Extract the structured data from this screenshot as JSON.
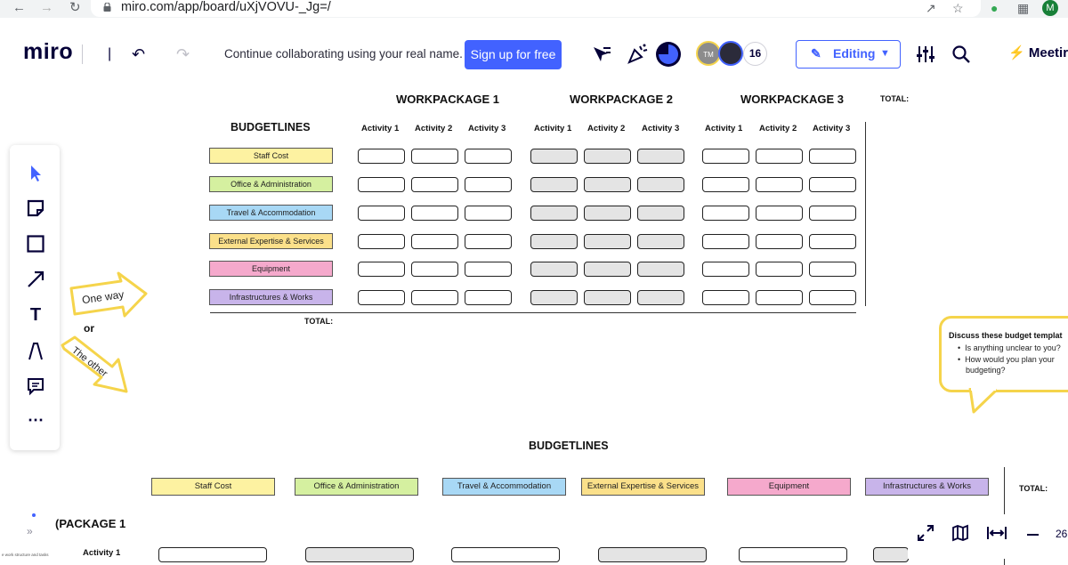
{
  "browser": {
    "url": "miro.com/app/board/uXjVOVU-_Jg=/",
    "profile_initial": "M"
  },
  "toolbar": {
    "logo": "miro",
    "cta_text": "Continue collaborating using your real name.",
    "signup_label": "Sign up for free",
    "avatar_tm": "TM",
    "collaborator_count": "16",
    "editing_label": "Editing",
    "meeting_label": "Meetir"
  },
  "board": {
    "workpackages": [
      "WORKPACKAGE 1",
      "WORKPACKAGE 2",
      "WORKPACKAGE 3"
    ],
    "total_header": "TOTAL:",
    "budgetlines_title": "BUDGETLINES",
    "activities": [
      "Activity 1",
      "Activity 2",
      "Activity 3"
    ],
    "budgetlines": [
      {
        "label": "Staff Cost",
        "color": "#fdf2a1"
      },
      {
        "label": "Office & Administration",
        "color": "#d5f0a0"
      },
      {
        "label": "Travel & Accommodation",
        "color": "#a8d8f5"
      },
      {
        "label": "External Expertise & Services",
        "color": "#fbe08a"
      },
      {
        "label": "Equipment",
        "color": "#f5a9cc"
      },
      {
        "label": "Infrastructures & Works",
        "color": "#c8b4ea"
      }
    ],
    "total_row_label": "TOTAL:",
    "arrow_one": "One way",
    "or_text": "or",
    "arrow_other": "The other",
    "bubble": {
      "title": "Discuss these budget templat",
      "items": [
        "Is anything unclear to you?",
        "How would you plan your",
        "budgeting?"
      ]
    },
    "bottom": {
      "title": "BUDGETLINES",
      "total_label": "TOTAL:",
      "workpackage_partial": "(PACKAGE 1",
      "activity_label": "Activity 1",
      "tiny_text": "e work structure and tasks"
    }
  },
  "zoom_partial": "26",
  "colors": {
    "accent": "#4262ff",
    "sticky_yellow": "#f5d44b"
  }
}
